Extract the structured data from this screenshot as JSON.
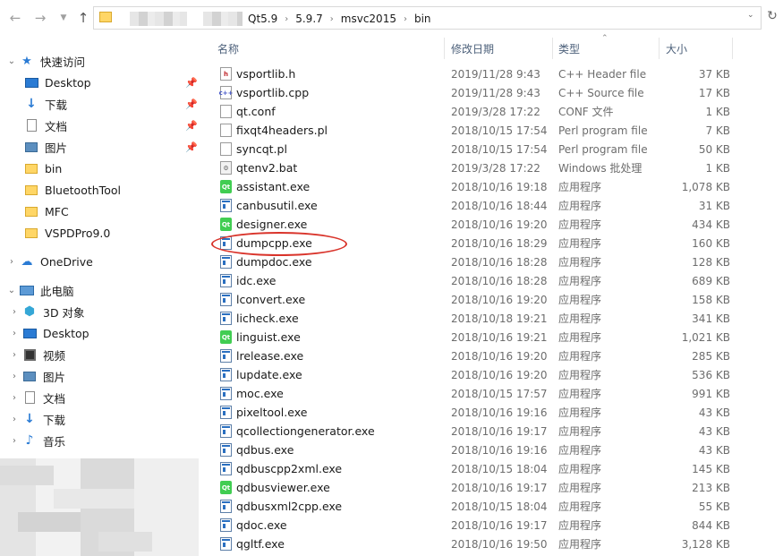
{
  "nav": {
    "back_icon": "back-arrow-icon",
    "forward_icon": "forward-arrow-icon",
    "up_icon": "up-arrow-icon"
  },
  "address": {
    "crumbs": [
      "Qt5.9",
      "5.9.7",
      "msvc2015",
      "bin"
    ]
  },
  "sidebar": {
    "quick_access": "快速访问",
    "pinned": [
      {
        "label": "Desktop",
        "icon": "desktop-icon"
      },
      {
        "label": "下载",
        "icon": "download-icon"
      },
      {
        "label": "文档",
        "icon": "documents-icon"
      },
      {
        "label": "图片",
        "icon": "pictures-icon"
      }
    ],
    "folders": [
      "bin",
      "BluetoothTool",
      "MFC",
      "VSPDPro9.0"
    ],
    "onedrive": "OneDrive",
    "this_pc": "此电脑",
    "pc_items": [
      {
        "label": "3D 对象",
        "icon": "3d-objects-icon"
      },
      {
        "label": "Desktop",
        "icon": "desktop-icon"
      },
      {
        "label": "视频",
        "icon": "video-icon"
      },
      {
        "label": "图片",
        "icon": "pictures-icon"
      },
      {
        "label": "文档",
        "icon": "documents-icon"
      },
      {
        "label": "下载",
        "icon": "download-icon"
      },
      {
        "label": "音乐",
        "icon": "music-icon"
      }
    ]
  },
  "columns": {
    "name": "名称",
    "date": "修改日期",
    "type": "类型",
    "size": "大小"
  },
  "files": [
    {
      "name": "vsportlib.h",
      "date": "2019/11/28 9:43",
      "type": "C++ Header file",
      "size": "37 KB",
      "icon": "h"
    },
    {
      "name": "vsportlib.cpp",
      "date": "2019/11/28 9:43",
      "type": "C++ Source file",
      "size": "17 KB",
      "icon": "cpp"
    },
    {
      "name": "qt.conf",
      "date": "2019/3/28 17:22",
      "type": "CONF 文件",
      "size": "1 KB",
      "icon": "txt"
    },
    {
      "name": "fixqt4headers.pl",
      "date": "2018/10/15 17:54",
      "type": "Perl program file",
      "size": "7 KB",
      "icon": "txt"
    },
    {
      "name": "syncqt.pl",
      "date": "2018/10/15 17:54",
      "type": "Perl program file",
      "size": "50 KB",
      "icon": "txt"
    },
    {
      "name": "qtenv2.bat",
      "date": "2019/3/28 17:22",
      "type": "Windows 批处理",
      "size": "1 KB",
      "icon": "bat"
    },
    {
      "name": "assistant.exe",
      "date": "2018/10/16 19:18",
      "type": "应用程序",
      "size": "1,078 KB",
      "icon": "qt"
    },
    {
      "name": "canbusutil.exe",
      "date": "2018/10/16 18:44",
      "type": "应用程序",
      "size": "31 KB",
      "icon": "exe"
    },
    {
      "name": "designer.exe",
      "date": "2018/10/16 19:20",
      "type": "应用程序",
      "size": "434 KB",
      "icon": "qt"
    },
    {
      "name": "dumpcpp.exe",
      "date": "2018/10/16 18:29",
      "type": "应用程序",
      "size": "160 KB",
      "icon": "exe"
    },
    {
      "name": "dumpdoc.exe",
      "date": "2018/10/16 18:28",
      "type": "应用程序",
      "size": "128 KB",
      "icon": "exe"
    },
    {
      "name": "idc.exe",
      "date": "2018/10/16 18:28",
      "type": "应用程序",
      "size": "689 KB",
      "icon": "exe"
    },
    {
      "name": "lconvert.exe",
      "date": "2018/10/16 19:20",
      "type": "应用程序",
      "size": "158 KB",
      "icon": "exe"
    },
    {
      "name": "licheck.exe",
      "date": "2018/10/18 19:21",
      "type": "应用程序",
      "size": "341 KB",
      "icon": "exe"
    },
    {
      "name": "linguist.exe",
      "date": "2018/10/16 19:21",
      "type": "应用程序",
      "size": "1,021 KB",
      "icon": "qt"
    },
    {
      "name": "lrelease.exe",
      "date": "2018/10/16 19:20",
      "type": "应用程序",
      "size": "285 KB",
      "icon": "exe"
    },
    {
      "name": "lupdate.exe",
      "date": "2018/10/16 19:20",
      "type": "应用程序",
      "size": "536 KB",
      "icon": "exe"
    },
    {
      "name": "moc.exe",
      "date": "2018/10/15 17:57",
      "type": "应用程序",
      "size": "991 KB",
      "icon": "exe"
    },
    {
      "name": "pixeltool.exe",
      "date": "2018/10/16 19:16",
      "type": "应用程序",
      "size": "43 KB",
      "icon": "exe"
    },
    {
      "name": "qcollectiongenerator.exe",
      "date": "2018/10/16 19:17",
      "type": "应用程序",
      "size": "43 KB",
      "icon": "exe"
    },
    {
      "name": "qdbus.exe",
      "date": "2018/10/16 19:16",
      "type": "应用程序",
      "size": "43 KB",
      "icon": "exe"
    },
    {
      "name": "qdbuscpp2xml.exe",
      "date": "2018/10/15 18:04",
      "type": "应用程序",
      "size": "145 KB",
      "icon": "exe"
    },
    {
      "name": "qdbusviewer.exe",
      "date": "2018/10/16 19:17",
      "type": "应用程序",
      "size": "213 KB",
      "icon": "qt"
    },
    {
      "name": "qdbusxml2cpp.exe",
      "date": "2018/10/15 18:04",
      "type": "应用程序",
      "size": "55 KB",
      "icon": "exe"
    },
    {
      "name": "qdoc.exe",
      "date": "2018/10/16 19:17",
      "type": "应用程序",
      "size": "844 KB",
      "icon": "exe"
    },
    {
      "name": "qgltf.exe",
      "date": "2018/10/16 19:50",
      "type": "应用程序",
      "size": "3,128 KB",
      "icon": "exe"
    }
  ],
  "highlighted_file": "dumpcpp.exe",
  "colors": {
    "accent": "#2a7bd4",
    "highlight_ellipse": "#d9342b",
    "header_text": "#4c607a"
  }
}
